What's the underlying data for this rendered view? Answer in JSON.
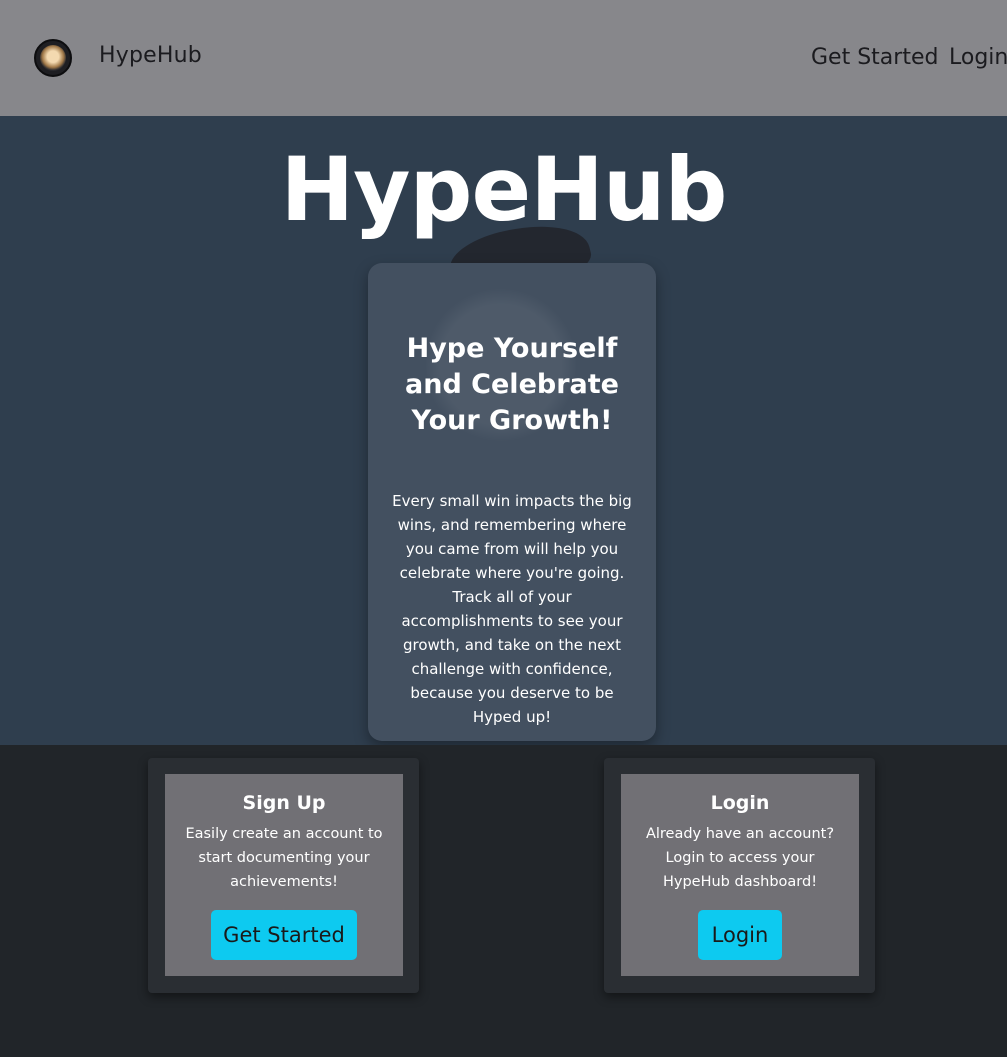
{
  "navbar": {
    "brand": "HypeHub",
    "links": [
      "Get Started",
      "Login"
    ]
  },
  "hero": {
    "title": "HypeHub",
    "card": {
      "title": "Hype Yourself and Celebrate Your Growth!",
      "body": "Every small win impacts the big wins, and remembering where you came from will help you celebrate where you're going. Track all of your accomplishments to see your growth, and take on the next challenge with confidence, because you deserve to be Hyped up!"
    }
  },
  "actions": {
    "signup": {
      "title": "Sign Up",
      "text": "Easily create an account to start documenting your achievements!",
      "button": "Get Started"
    },
    "login": {
      "title": "Login",
      "text": "Already have an account? Login to access your HypeHub dashboard!",
      "button": "Login"
    }
  },
  "colors": {
    "navbar": "#87878b",
    "hero": "#2f3e4e",
    "hero_card": "#435060",
    "footer": "#212529",
    "action_inner": "#717075",
    "button": "#0dcaf0"
  }
}
